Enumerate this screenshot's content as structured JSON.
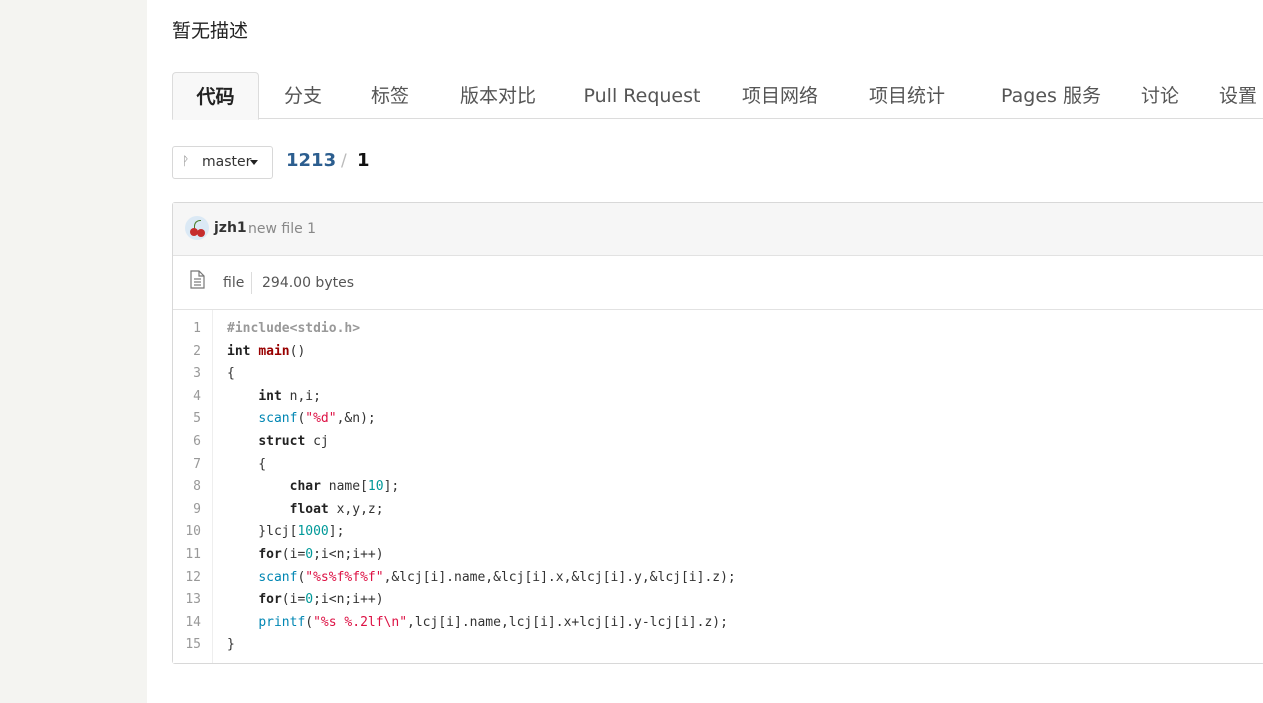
{
  "description": "暂无描述",
  "tabs": [
    {
      "label": "代码",
      "active": true
    },
    {
      "label": "分支"
    },
    {
      "label": "标签"
    },
    {
      "label": "版本对比"
    },
    {
      "label": "Pull Request"
    },
    {
      "label": "项目网络"
    },
    {
      "label": "项目统计"
    },
    {
      "label": "Pages 服务"
    },
    {
      "label": "讨论"
    },
    {
      "label": "设置"
    }
  ],
  "branch": {
    "label": "master"
  },
  "breadcrumb": {
    "repo": "1213",
    "separator": "/",
    "file": "1"
  },
  "commit": {
    "author": "jzh1",
    "message": "new file 1"
  },
  "file_info": {
    "type": "file",
    "size": "294.00 bytes"
  },
  "code": {
    "lines": [
      [
        [
          "pre",
          "#include<stdio.h>"
        ]
      ],
      [
        [
          "kw",
          "int"
        ],
        [
          "",
          " "
        ],
        [
          "fn",
          "main"
        ],
        [
          "",
          "()"
        ]
      ],
      [
        [
          "",
          "{"
        ]
      ],
      [
        [
          "",
          "    "
        ],
        [
          "kw",
          "int"
        ],
        [
          "",
          " n,i;"
        ]
      ],
      [
        [
          "",
          "    "
        ],
        [
          "call",
          "scanf"
        ],
        [
          "",
          "("
        ],
        [
          "str",
          "\"%d\""
        ],
        [
          "",
          ",&n);"
        ]
      ],
      [
        [
          "",
          "    "
        ],
        [
          "kw",
          "struct"
        ],
        [
          "",
          " cj"
        ]
      ],
      [
        [
          "",
          "    {"
        ]
      ],
      [
        [
          "",
          "        "
        ],
        [
          "kw",
          "char"
        ],
        [
          "",
          " name["
        ],
        [
          "num",
          "10"
        ],
        [
          "",
          "];"
        ]
      ],
      [
        [
          "",
          "        "
        ],
        [
          "kw",
          "float"
        ],
        [
          "",
          " x,y,z;"
        ]
      ],
      [
        [
          "",
          "    }lcj["
        ],
        [
          "num",
          "1000"
        ],
        [
          "",
          "];"
        ]
      ],
      [
        [
          "",
          "    "
        ],
        [
          "kw",
          "for"
        ],
        [
          "",
          "(i="
        ],
        [
          "num",
          "0"
        ],
        [
          "",
          ";i<n;i++)"
        ]
      ],
      [
        [
          "",
          "    "
        ],
        [
          "call",
          "scanf"
        ],
        [
          "",
          "("
        ],
        [
          "str",
          "\"%s%f%f%f\""
        ],
        [
          "",
          ",&lcj[i].name,&lcj[i].x,&lcj[i].y,&lcj[i].z);"
        ]
      ],
      [
        [
          "",
          "    "
        ],
        [
          "kw",
          "for"
        ],
        [
          "",
          "(i="
        ],
        [
          "num",
          "0"
        ],
        [
          "",
          ";i<n;i++)"
        ]
      ],
      [
        [
          "",
          "    "
        ],
        [
          "call",
          "printf"
        ],
        [
          "",
          "("
        ],
        [
          "str",
          "\"%s %.2lf\\n\""
        ],
        [
          "",
          ",lcj[i].name,lcj[i].x+lcj[i].y-lcj[i].z);"
        ]
      ],
      [
        [
          "",
          "}"
        ]
      ]
    ]
  },
  "icons": {
    "branch": "branch-icon",
    "file": "file-icon",
    "avatar": "cherry-avatar"
  }
}
